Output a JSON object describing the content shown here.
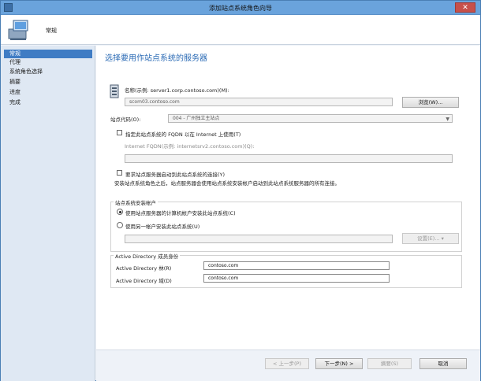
{
  "window": {
    "title": "添加站点系统角色向导",
    "close": "✕"
  },
  "header": {
    "title": "常规"
  },
  "nav": {
    "items": [
      "常规",
      "代理",
      "系统角色选择",
      "摘要",
      "进度",
      "完成"
    ]
  },
  "main": {
    "heading": "选择要用作站点系统的服务器",
    "name_label": "名称(示例: server1.corp.contoso.com)(M):",
    "name_value": "scom03.contoso.com",
    "browse_button": "浏览(W)...",
    "site_code_label": "站点代码(O):",
    "site_code_value": "004 - 广州独立主站点",
    "fqdn_checkbox": "指定此站点系统的 FQDN 以在 Internet 上使用(T)",
    "internet_fqdn_label": "Internet FQDN(示例: internetsrv2.contoso.com)(Q):",
    "internet_fqdn_value": "",
    "require_init_checkbox": "要求站点服务器启动到此站点系统的连接(Y)",
    "info_text": "安装站点系统角色之后，站点服务器会使用站点系统安装帐户启动到此站点系统服务器的所有连接。",
    "install_account_group": "站点系统安装帐户",
    "radio_computer_account": "使用站点服务器的计算机帐户安装此站点系统(C)",
    "radio_other_account": "使用另一帐户安装此站点系统(U)",
    "other_account_value": "",
    "settings_button": "设置(E)...",
    "ad_group": "Active Directory 成员身份",
    "ad_forest_label": "Active Directory 林(R)",
    "ad_forest_value": "contoso.com",
    "ad_domain_label": "Active Directory 域(D)",
    "ad_domain_value": "contoso.com"
  },
  "footer": {
    "prev_button": "< 上一步(P)",
    "next_button": "下一步(N) >",
    "summary_button": "摘要(S)",
    "cancel_button": "取消"
  },
  "colors": {
    "accent": "#3f7cc4",
    "title_text": "#2a6ab5",
    "titlebar": "#6aa3dc"
  }
}
